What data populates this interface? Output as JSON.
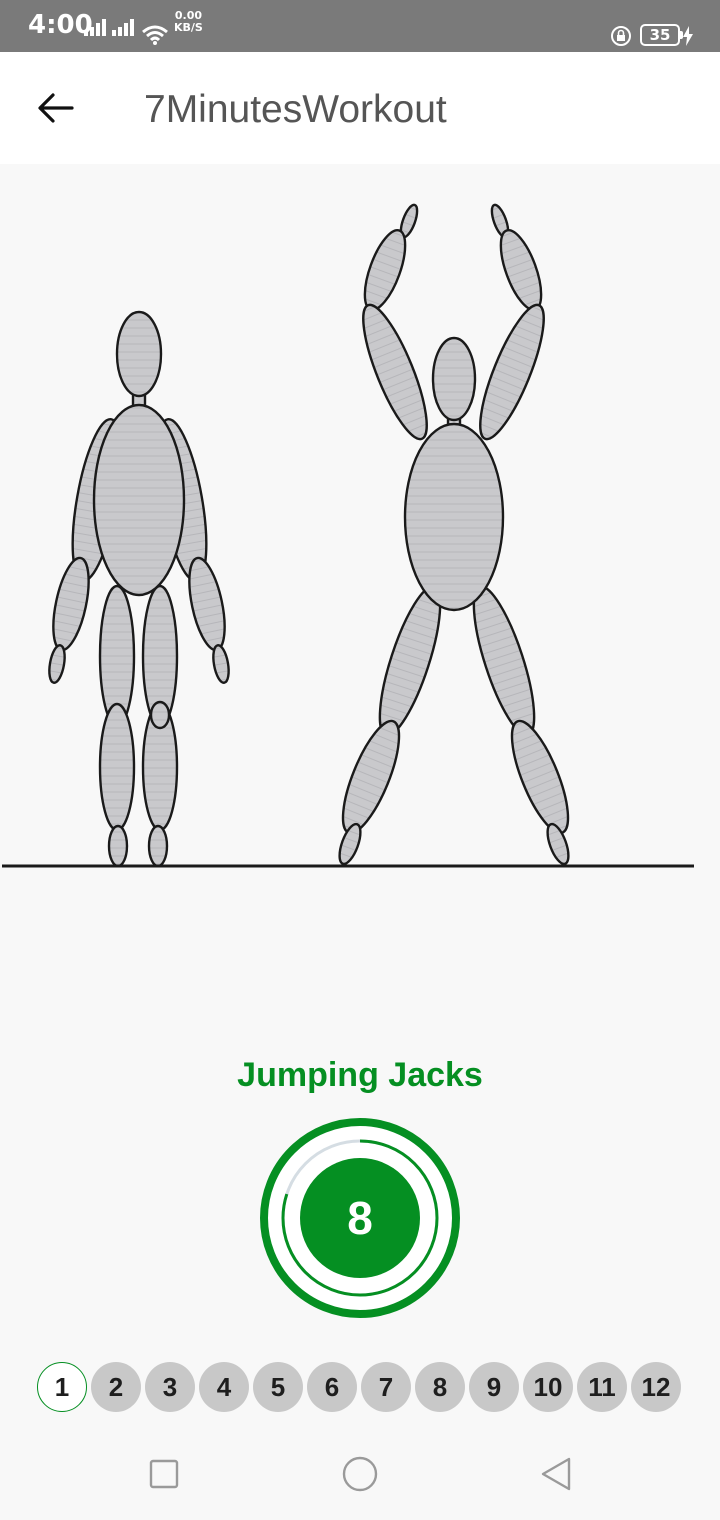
{
  "status_bar": {
    "time": "4:00",
    "net_speed_value": "0.00",
    "net_speed_unit": "KB/S",
    "battery": "35"
  },
  "toolbar": {
    "title": "7MinutesWorkout"
  },
  "exercise": {
    "name": "Jumping Jacks",
    "timer_value": "8",
    "timer_progress": 0.8
  },
  "steps": [
    {
      "label": "1",
      "state": "current"
    },
    {
      "label": "2",
      "state": "upcoming"
    },
    {
      "label": "3",
      "state": "upcoming"
    },
    {
      "label": "4",
      "state": "upcoming"
    },
    {
      "label": "5",
      "state": "upcoming"
    },
    {
      "label": "6",
      "state": "upcoming"
    },
    {
      "label": "7",
      "state": "upcoming"
    },
    {
      "label": "8",
      "state": "upcoming"
    },
    {
      "label": "9",
      "state": "upcoming"
    },
    {
      "label": "10",
      "state": "upcoming"
    },
    {
      "label": "11",
      "state": "upcoming"
    },
    {
      "label": "12",
      "state": "upcoming"
    }
  ],
  "colors": {
    "accent": "#058f22",
    "step_inactive": "#c8c8c8",
    "status_bar": "#7a7a7a"
  },
  "icons": {
    "back": "arrow-left-icon",
    "nav_recents": "square-icon",
    "nav_home": "circle-icon",
    "nav_back": "triangle-icon"
  }
}
